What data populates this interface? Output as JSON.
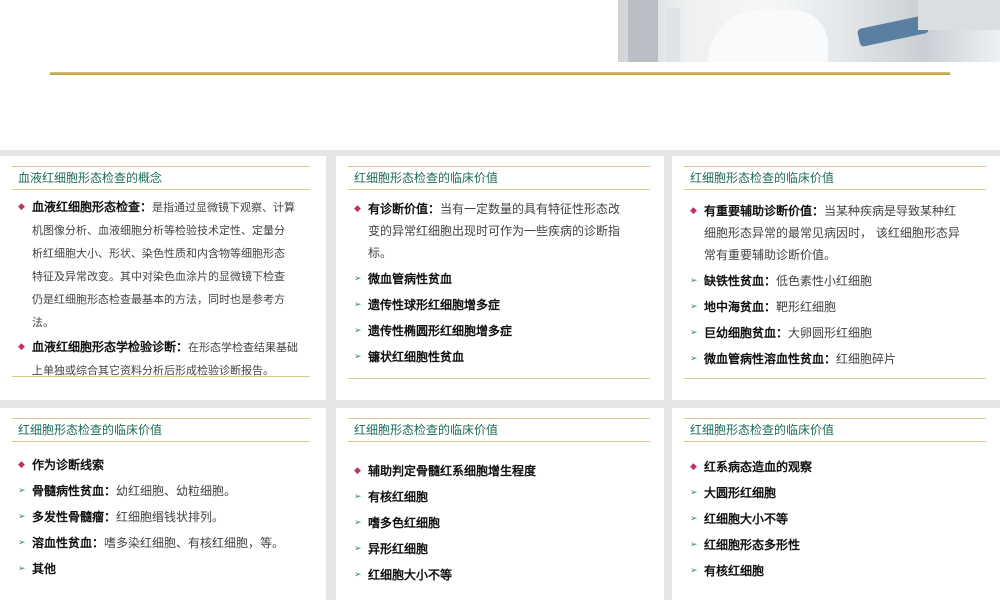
{
  "header": {
    "photo_desc_icon": "lab-photo"
  },
  "cards": [
    {
      "title": "血液红细胞形态检查的概念",
      "items": [
        {
          "bullet": "◆",
          "label": "血液红细胞形态检查：",
          "lines": [
            "是指通过显微镜下观察、计算",
            "机图像分析、血液细胞分析等检验技术定性、定量分",
            "析红细胞大小、形状、染色性质和内含物等细胞形态",
            "特征及异常改变。其中对染色血涂片的显微镜下检查",
            "仍是红细胞形态检查最基本的方法，同时也是参考方",
            "法。"
          ]
        },
        {
          "bullet": "◆",
          "label": "血液红细胞形态学检验诊断：",
          "lines": [
            "在形态学检查结果基础",
            "上单独或综合其它资料分析后形成检验诊断报告。"
          ]
        }
      ]
    },
    {
      "title": "红细胞形态检查的临床价值",
      "items": [
        {
          "bullet": "◆",
          "label": "有诊断价值：",
          "lines": [
            "当有一定数量的具有特征性形态改",
            "变的异常红细胞出现时可作为一些疾病的诊断指",
            "标。"
          ]
        },
        {
          "bullet": "➢",
          "label": "微血管病性贫血",
          "lines": []
        },
        {
          "bullet": "➢",
          "label": "遗传性球形红细胞增多症",
          "lines": []
        },
        {
          "bullet": "➢",
          "label": "遗传性椭圆形红细胞增多症",
          "lines": []
        },
        {
          "bullet": "➢",
          "label": "镰状红细胞性贫血",
          "lines": []
        }
      ]
    },
    {
      "title": "红细胞形态检查的临床价值",
      "items": [
        {
          "bullet": "◆",
          "label": "有重要辅助诊断价值：",
          "lines": [
            "当某种疾病是导致某种红",
            "细胞形态异常的最常见病因时，  该红细胞形态异",
            "常有重要辅助诊断价值。"
          ]
        },
        {
          "bullet": "➢",
          "label": "缺铁性贫血：",
          "lines": [
            "低色素性小红细胞"
          ]
        },
        {
          "bullet": "➢",
          "label": "地中海贫血：",
          "lines": [
            "靶形红细胞"
          ]
        },
        {
          "bullet": "➢",
          "label": "巨幼细胞贫血：",
          "lines": [
            "大卵圆形红细胞"
          ]
        },
        {
          "bullet": "➢",
          "label": "微血管病性溶血性贫血：",
          "lines": [
            "红细胞碎片"
          ]
        }
      ]
    },
    {
      "title": "红细胞形态检查的临床价值",
      "items": [
        {
          "bullet": "◆",
          "label": "作为诊断线索",
          "lines": []
        },
        {
          "bullet": "➢",
          "label": "骨髓病性贫血：",
          "lines": [
            "幼红细胞、幼粒细胞。"
          ]
        },
        {
          "bullet": "➢",
          "label": "多发性骨髓瘤：",
          "lines": [
            "红细胞缗钱状排列。"
          ]
        },
        {
          "bullet": "➢",
          "label": "溶血性贫血：",
          "lines": [
            "嗜多染红细胞、有核红细胞，等。"
          ]
        },
        {
          "bullet": "➢",
          "label": "其他",
          "lines": []
        }
      ]
    },
    {
      "title": "红细胞形态检查的临床价值",
      "items": [
        {
          "bullet": "◆",
          "label": "辅助判定骨髓红系细胞增生程度",
          "lines": []
        },
        {
          "bullet": "➢",
          "label": "有核红细胞",
          "lines": []
        },
        {
          "bullet": "➢",
          "label": "嗜多色红细胞",
          "lines": []
        },
        {
          "bullet": "➢",
          "label": "异形红细胞",
          "lines": []
        },
        {
          "bullet": "➢",
          "label": "红细胞大小不等",
          "lines": []
        }
      ]
    },
    {
      "title": "红细胞形态检查的临床价值",
      "items": [
        {
          "bullet": "◆",
          "label": "红系病态造血的观察",
          "lines": []
        },
        {
          "bullet": "➢",
          "label": "大圆形红细胞",
          "lines": []
        },
        {
          "bullet": "➢",
          "label": "红细胞大小不等",
          "lines": []
        },
        {
          "bullet": "➢",
          "label": "红细胞形态多形性",
          "lines": []
        },
        {
          "bullet": "➢",
          "label": "有核红细胞",
          "lines": []
        }
      ]
    }
  ],
  "colors": {
    "title": "#1f6b57",
    "rule": "#d8c88a",
    "diamond": "#c0306a",
    "arrow": "#2f8a5a"
  }
}
